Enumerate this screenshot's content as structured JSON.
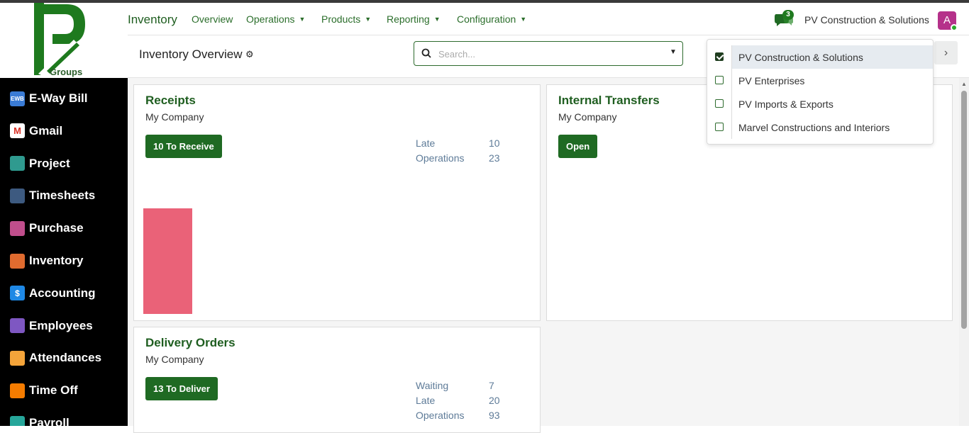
{
  "logo": {
    "text": "Groups"
  },
  "sidebar": {
    "items": [
      {
        "label": "E-Way Bill",
        "icon": "eway-bill-icon",
        "icon_text": "EWB",
        "color": "#3a7bd5"
      },
      {
        "label": "Gmail",
        "icon": "gmail-icon",
        "color": "#ffffff"
      },
      {
        "label": "Project",
        "icon": "project-icon",
        "color": "#2f9a8f"
      },
      {
        "label": "Timesheets",
        "icon": "timesheets-icon",
        "color": "#3d5a80"
      },
      {
        "label": "Purchase",
        "icon": "purchase-icon",
        "color": "#c04e8c"
      },
      {
        "label": "Inventory",
        "icon": "inventory-icon",
        "color": "#e06b2f"
      },
      {
        "label": "Accounting",
        "icon": "accounting-icon",
        "icon_text": "$",
        "color": "#1e88e5"
      },
      {
        "label": "Employees",
        "icon": "employees-icon",
        "color": "#7e57c2"
      },
      {
        "label": "Attendances",
        "icon": "attendances-icon",
        "color": "#f4a43a"
      },
      {
        "label": "Time Off",
        "icon": "time-off-icon",
        "color": "#f57c00"
      },
      {
        "label": "Payroll",
        "icon": "payroll-icon",
        "color": "#26a69a"
      }
    ]
  },
  "navbar": {
    "app_name": "Inventory",
    "menus": [
      "Overview",
      "Operations",
      "Products",
      "Reporting",
      "Configuration"
    ],
    "messages_count": "3",
    "company": "PV Construction & Solutions",
    "avatar_letter": "A"
  },
  "control": {
    "breadcrumb": "Inventory Overview",
    "search_placeholder": "Search..."
  },
  "cards": {
    "receipts": {
      "title": "Receipts",
      "company": "My Company",
      "button": "10 To Receive",
      "stats": [
        {
          "label": "Late",
          "value": "10"
        },
        {
          "label": "Operations",
          "value": "23"
        }
      ],
      "graph_bar_fraction": 0.9
    },
    "internal": {
      "title": "Internal Transfers",
      "company": "My Company",
      "button": "Open"
    },
    "delivery": {
      "title": "Delivery Orders",
      "company": "My Company",
      "button": "13 To Deliver",
      "stats": [
        {
          "label": "Waiting",
          "value": "7"
        },
        {
          "label": "Late",
          "value": "20"
        },
        {
          "label": "Operations",
          "value": "93"
        }
      ]
    }
  },
  "company_switcher": {
    "items": [
      {
        "label": "PV Construction & Solutions",
        "checked": true
      },
      {
        "label": "PV Enterprises",
        "checked": false
      },
      {
        "label": "PV Imports & Exports",
        "checked": false
      },
      {
        "label": "Marvel Constructions and Interiors",
        "checked": false
      }
    ]
  },
  "colors": {
    "brand_green": "#1f6a23",
    "bar_pink": "#ea6278",
    "stat_blue": "#5e7b98"
  }
}
